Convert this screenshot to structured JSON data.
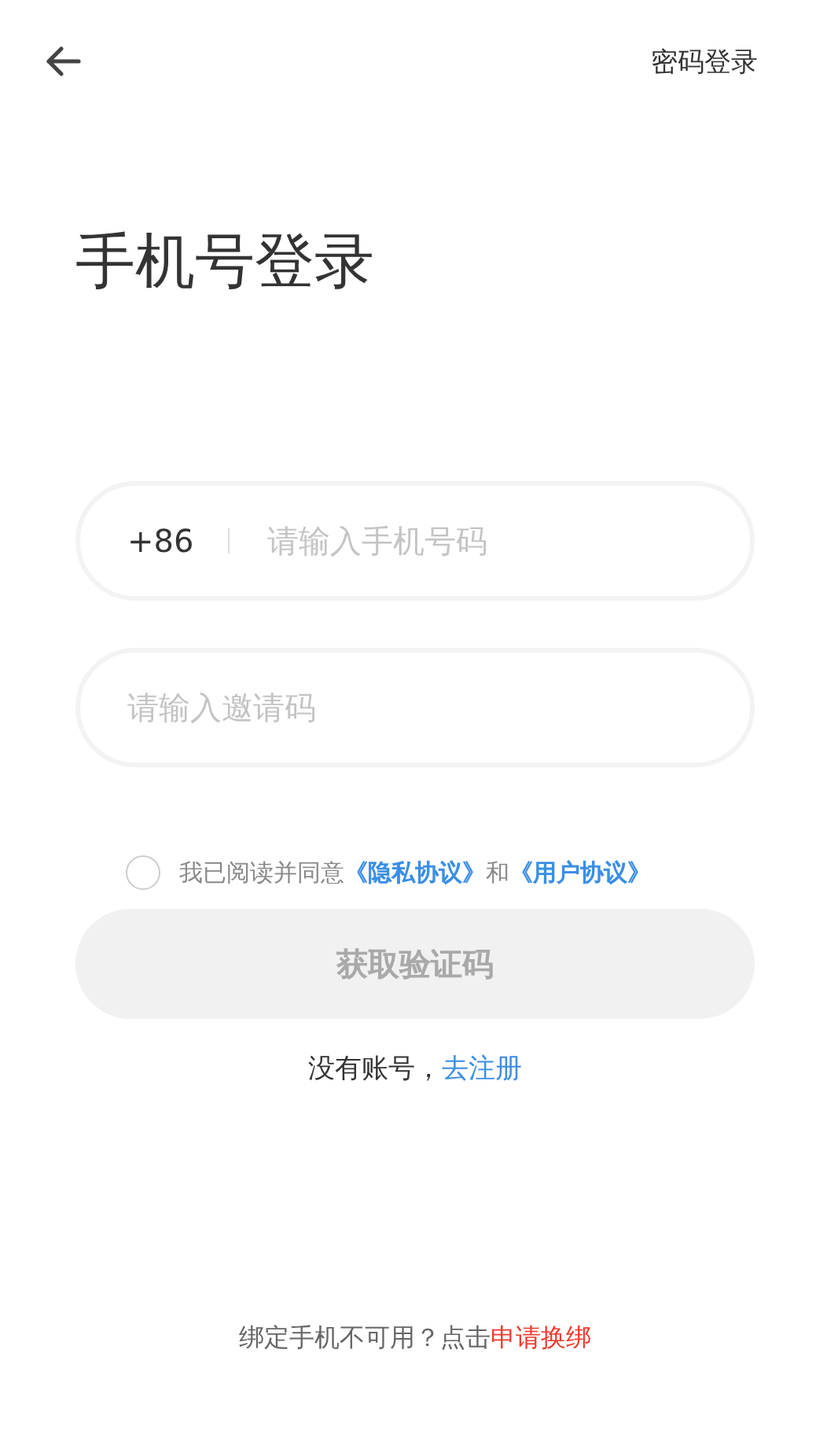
{
  "header": {
    "switch_link": "密码登录"
  },
  "title": "手机号登录",
  "phone_field": {
    "country_code": "+86",
    "placeholder": "请输入手机号码"
  },
  "invite_field": {
    "placeholder": "请输入邀请码"
  },
  "agreement": {
    "checked": false,
    "parts": [
      {
        "kind": "text",
        "text": "我已阅读并同意"
      },
      {
        "kind": "link",
        "text": "《隐私协议》"
      },
      {
        "kind": "text",
        "text": "和"
      },
      {
        "kind": "link",
        "text": "《用户协议》"
      }
    ]
  },
  "submit_button": {
    "label": "获取验证码",
    "disabled": true
  },
  "register": {
    "text": "没有账号，",
    "link": "去注册"
  },
  "rebind": {
    "text": "绑定手机不可用？点击",
    "link": "申请换绑"
  }
}
